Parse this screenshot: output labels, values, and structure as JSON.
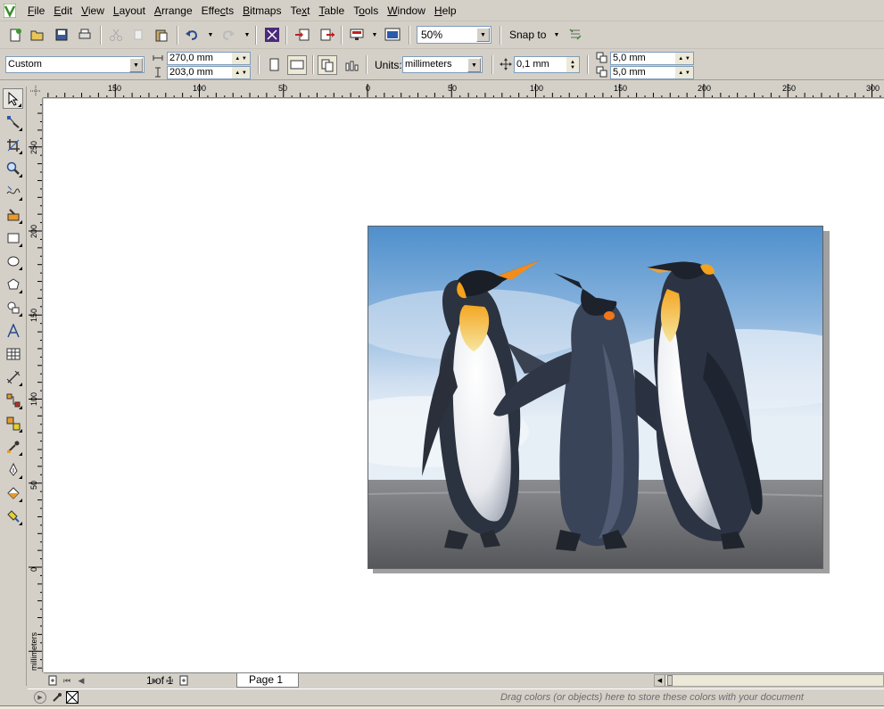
{
  "menubar": {
    "items": [
      "File",
      "Edit",
      "View",
      "Layout",
      "Arrange",
      "Effects",
      "Bitmaps",
      "Text",
      "Table",
      "Tools",
      "Window",
      "Help"
    ],
    "underline": [
      "F",
      "E",
      "V",
      "L",
      "A",
      "c",
      "B",
      "x",
      "T",
      "o",
      "W",
      "H"
    ]
  },
  "toolbar": {
    "zoom_value": "50%",
    "snap_label": "Snap to"
  },
  "property_bar": {
    "page_preset": "Custom",
    "width": "270,0 mm",
    "height": "203,0 mm",
    "units_label": "Units:",
    "units_value": "millimeters",
    "nudge": "0,1 mm",
    "dup_x": "5,0 mm",
    "dup_y": "5,0 mm"
  },
  "h_ruler": {
    "labels": [
      "150",
      "100",
      "50",
      "0",
      "50",
      "100",
      "150",
      "200",
      "250",
      "300"
    ]
  },
  "v_ruler": {
    "labels": [
      "250",
      "200",
      "150",
      "100",
      "50",
      "0"
    ],
    "units": "millimeters"
  },
  "page_nav": {
    "count": "1 of 1",
    "tab": "Page 1"
  },
  "palette": {
    "hint": "Drag colors (or objects) here to store these colors with your document"
  },
  "colors": {
    "chrome": "#d4d0c8",
    "canvas": "#ffffff",
    "accent_green": "#3a8a2a"
  }
}
